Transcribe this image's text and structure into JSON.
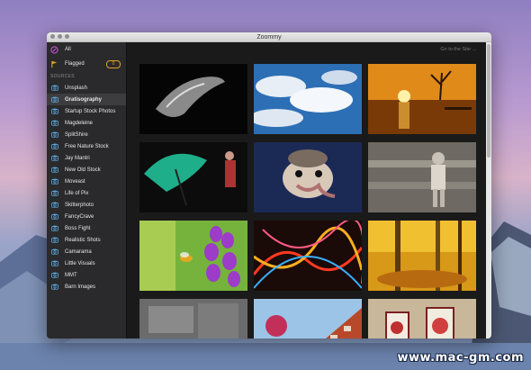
{
  "window": {
    "title": "Zoommy"
  },
  "sidebar": {
    "top_items": [
      {
        "label": "All",
        "icon": "compass-icon"
      },
      {
        "label": "Flagged",
        "icon": "flag-icon",
        "badge": "0"
      }
    ],
    "section_label": "SOURCES",
    "sources": [
      "Unsplash",
      "Gratisography",
      "Startup Stock Photos",
      "Magdeleine",
      "SplitShire",
      "Free Nature Stock",
      "Jay Mantri",
      "New Old Stock",
      "Moveast",
      "Life of Pix",
      "Skitterphoto",
      "FancyCrave",
      "Boss Fight",
      "Realistic Shots",
      "Camarama",
      "Little Visuals",
      "MMT",
      "Barn Images"
    ],
    "active_source": "Gratisography"
  },
  "content": {
    "goto_label": "Go to the Site →"
  },
  "photos": [
    "dark-abstract-photo",
    "clouds-sky-photo",
    "lake-sunset-photo",
    "green-umbrella-photo",
    "ostrich-photo",
    "child-fence-photo",
    "bee-flower-photo",
    "light-trails-photo",
    "autumn-forest-photo",
    "stone-texture-photo",
    "red-building-photo",
    "street-art-photo"
  ],
  "watermark": "www.mac-gm.com",
  "colors": {
    "accent_badge": "#e0a020",
    "sidebar_bg": "#2a2a2c",
    "active_bg": "#3d3d40"
  }
}
